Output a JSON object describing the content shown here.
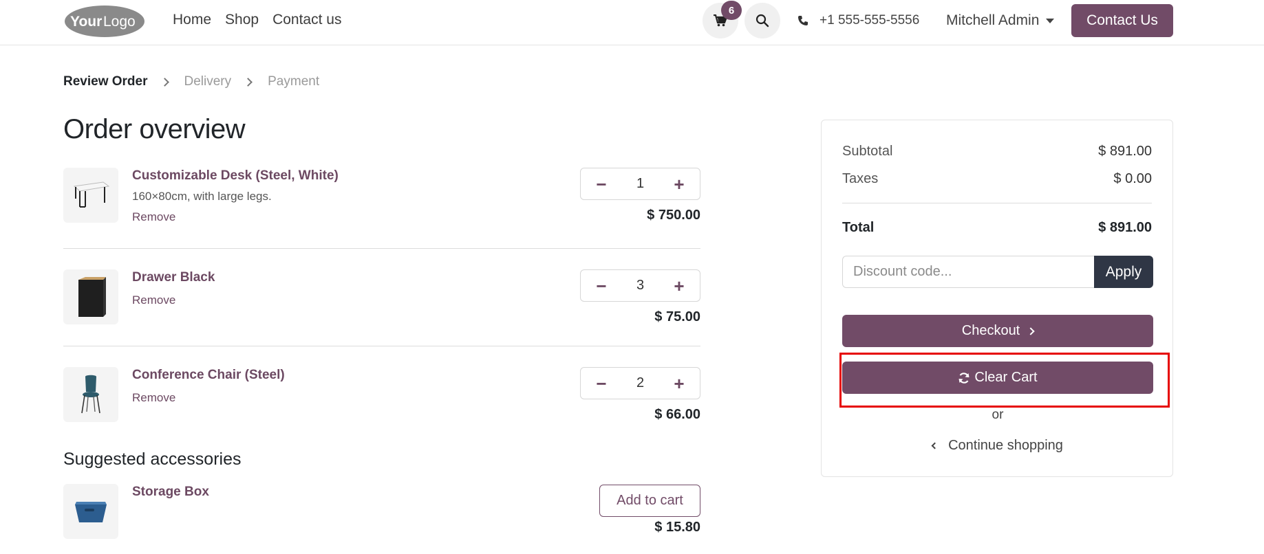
{
  "header": {
    "logo_text": "YourLogo",
    "nav": [
      "Home",
      "Shop",
      "Contact us"
    ],
    "cart_count": "6",
    "phone": "+1 555-555-5556",
    "user": "Mitchell Admin",
    "contact_button": "Contact Us"
  },
  "breadcrumb": {
    "step1": "Review Order",
    "step2": "Delivery",
    "step3": "Payment"
  },
  "page_title": "Order overview",
  "cart": {
    "lines": [
      {
        "name": "Customizable Desk (Steel, White)",
        "description": "160×80cm, with large legs.",
        "remove": "Remove",
        "qty": "1",
        "price": "$ 750.00"
      },
      {
        "name": "Drawer Black",
        "remove": "Remove",
        "qty": "3",
        "price": "$ 75.00"
      },
      {
        "name": "Conference Chair (Steel)",
        "remove": "Remove",
        "qty": "2",
        "price": "$ 66.00"
      }
    ]
  },
  "suggested": {
    "title": "Suggested accessories",
    "items": [
      {
        "name": "Storage Box",
        "button": "Add to cart",
        "price": "$ 15.80"
      }
    ]
  },
  "summary": {
    "subtotal_label": "Subtotal",
    "subtotal_value": "$ 891.00",
    "taxes_label": "Taxes",
    "taxes_value": "$ 0.00",
    "total_label": "Total",
    "total_value": "$ 891.00",
    "discount_placeholder": "Discount code...",
    "apply": "Apply",
    "checkout": "Checkout",
    "clear_cart": "Clear Cart",
    "or": "or",
    "continue": "Continue shopping"
  },
  "colors": {
    "brand": "#714b67",
    "dark_button": "#2f3645",
    "highlight": "#e60000"
  }
}
